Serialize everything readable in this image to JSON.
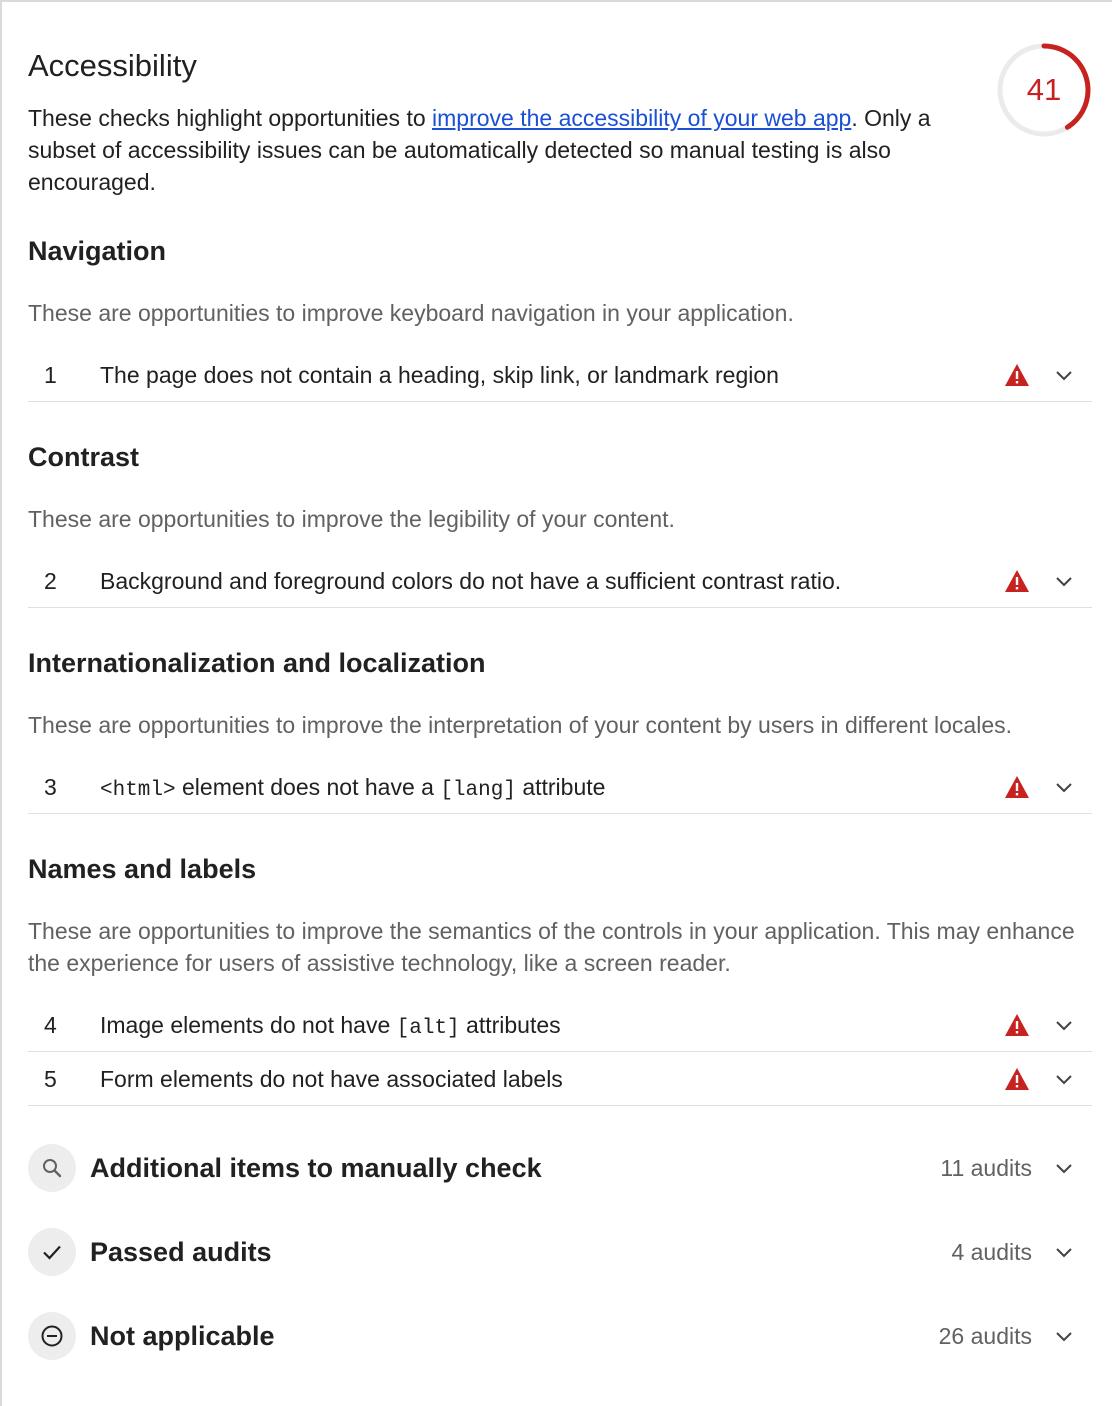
{
  "category": {
    "title": "Accessibility",
    "description_before": "These checks highlight opportunities to ",
    "link_text": "improve the accessibility of your web app",
    "description_after": ". Only a subset of accessibility issues can be automatically detected so manual testing is also encouraged.",
    "score": "41",
    "score_fraction": 0.41,
    "score_color": "#c7221f"
  },
  "groups": [
    {
      "title": "Navigation",
      "description": "These are opportunities to improve keyboard navigation in your application.",
      "audits": [
        {
          "number": "1",
          "title": "The page does not contain a heading, skip link, or landmark region",
          "status_icon": "warning-triangle-icon"
        }
      ]
    },
    {
      "title": "Contrast",
      "description": "These are opportunities to improve the legibility of your content.",
      "audits": [
        {
          "number": "2",
          "title": "Background and foreground colors do not have a sufficient contrast ratio.",
          "status_icon": "warning-triangle-icon"
        }
      ]
    },
    {
      "title": "Internationalization and localization",
      "description": "These are opportunities to improve the interpretation of your content by users in different locales.",
      "audits": [
        {
          "number": "3",
          "title_parts": [
            "<html>",
            " element does not have a ",
            "[lang]",
            " attribute"
          ],
          "status_icon": "warning-triangle-icon"
        }
      ]
    },
    {
      "title": "Names and labels",
      "description": "These are opportunities to improve the semantics of the controls in your application. This may enhance the experience for users of assistive technology, like a screen reader.",
      "audits": [
        {
          "number": "4",
          "title_parts": [
            "Image elements do not have ",
            "[alt]",
            " attributes"
          ],
          "status_icon": "warning-triangle-icon"
        },
        {
          "number": "5",
          "title": "Form elements do not have associated labels",
          "status_icon": "warning-triangle-icon"
        }
      ]
    }
  ],
  "summaries": [
    {
      "title": "Additional items to manually check",
      "count": "11 audits",
      "icon": "search-icon"
    },
    {
      "title": "Passed audits",
      "count": "4 audits",
      "icon": "checkmark-icon"
    },
    {
      "title": "Not applicable",
      "count": "26 audits",
      "icon": "minus-circle-icon"
    }
  ],
  "colors": {
    "fail": "#c7221f",
    "link": "#1a4fd6",
    "text": "#212121",
    "muted": "#616161"
  }
}
